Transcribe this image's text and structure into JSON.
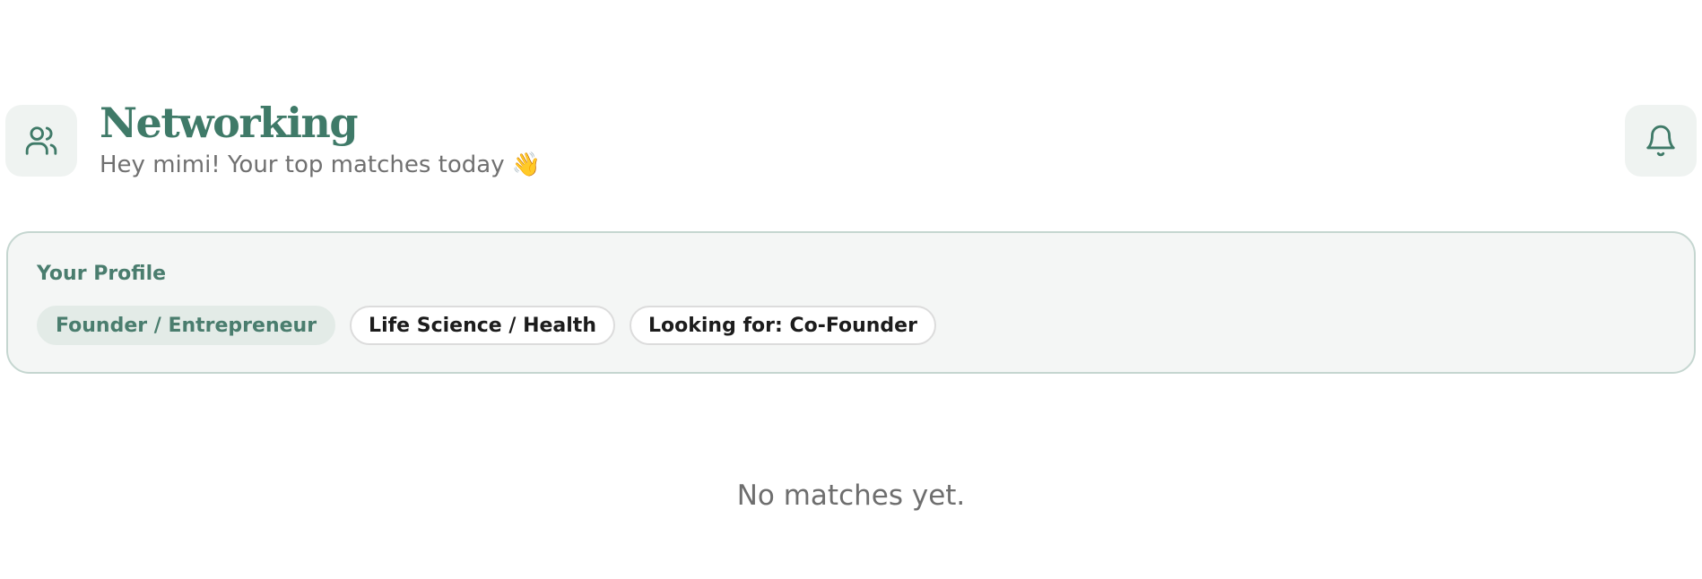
{
  "header": {
    "title": "Networking",
    "subtitle": "Hey mimi! Your top matches today 👋",
    "left_icon": "users-icon",
    "right_icon": "bell-icon"
  },
  "profile": {
    "label": "Your Profile",
    "tags": [
      {
        "label": "Founder / Entrepreneur",
        "style": "primary"
      },
      {
        "label": "Life Science / Health",
        "style": "outline"
      },
      {
        "label": "Looking for: Co-Founder",
        "style": "outline"
      }
    ]
  },
  "matches": {
    "empty_text": "No matches yet."
  },
  "colors": {
    "brand_green": "#3f7a68",
    "tile_background": "#eff3f1",
    "card_border": "#c5d6d0",
    "card_background": "#f4f6f5"
  }
}
